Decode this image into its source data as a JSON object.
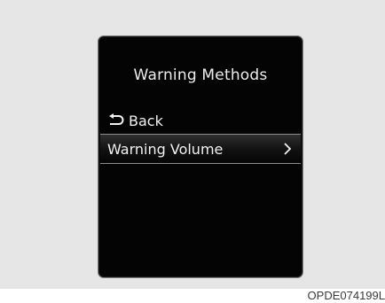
{
  "screen": {
    "title": "Warning Methods",
    "back": {
      "label": "Back",
      "icon": "return-arrow-icon"
    },
    "items": [
      {
        "label": "Warning Volume",
        "icon": "chevron-right-icon",
        "selected": true
      }
    ]
  },
  "caption": "OPDE074199L",
  "colors": {
    "panel_background": "#e6e6e6",
    "screen_background": "#040404",
    "screen_border": "#7a7a7a",
    "text": "#f2f2f2"
  }
}
